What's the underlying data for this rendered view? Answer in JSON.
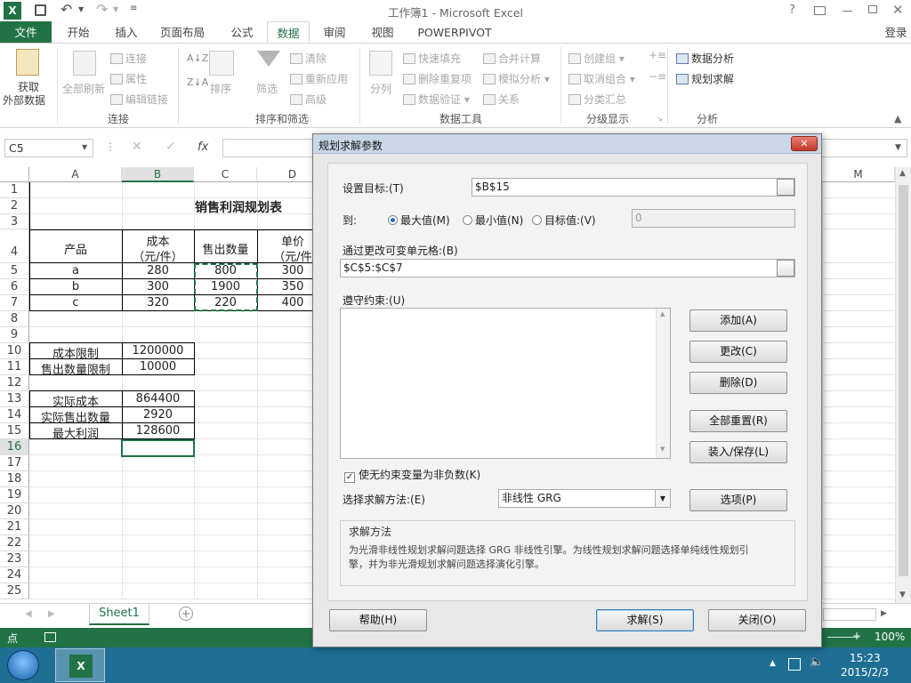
{
  "titlebar": {
    "title": "工作簿1 - Microsoft Excel",
    "help": "?",
    "login": "登录"
  },
  "tabs": {
    "file": "文件",
    "home": "开始",
    "insert": "插入",
    "layout": "页面布局",
    "formula": "公式",
    "data": "数据",
    "review": "审阅",
    "view": "视图",
    "powerpivot": "POWERPIVOT"
  },
  "ribbon": {
    "get_external_1": "获取",
    "get_external_2": "外部数据",
    "refresh_all": "全部刷新",
    "connections": "连接",
    "properties": "属性",
    "edit_links": "编辑链接",
    "group_connections": "连接",
    "sort": "排序",
    "filter": "筛选",
    "clear": "清除",
    "reapply": "重新应用",
    "advanced": "高级",
    "group_sort": "排序和筛选",
    "text_to_cols": "分列",
    "flash_fill": "快速填充",
    "remove_dup": "删除重复项",
    "validation": "数据验证",
    "consolidate": "合并计算",
    "what_if": "模拟分析",
    "relationships": "关系",
    "group_datatools": "数据工具",
    "group": "创建组",
    "ungroup": "取消组合",
    "subtotal": "分类汇总",
    "group_outline": "分级显示",
    "analysis": "数据分析",
    "solver": "规划求解",
    "group_analysis": "分析"
  },
  "formula_bar": {
    "name_box": "C5",
    "fx": "fx"
  },
  "columns": [
    "A",
    "B",
    "C",
    "D",
    "M"
  ],
  "rows": [
    "1",
    "2",
    "3",
    "4",
    "5",
    "6",
    "7",
    "8",
    "9",
    "10",
    "11",
    "12",
    "13",
    "14",
    "15",
    "16",
    "17",
    "18",
    "19",
    "20",
    "21",
    "22",
    "23",
    "24",
    "25"
  ],
  "sheet": {
    "title": "销售利润规划表",
    "headers": {
      "product": "产品",
      "cost_1": "成本",
      "cost_2": "（元/件）",
      "qty": "售出数量",
      "price_1": "单价",
      "price_2": "（元/件"
    },
    "products": [
      {
        "name": "a",
        "cost": "280",
        "qty": "800",
        "price": "300"
      },
      {
        "name": "b",
        "cost": "300",
        "qty": "1900",
        "price": "350"
      },
      {
        "name": "c",
        "cost": "320",
        "qty": "220",
        "price": "400"
      }
    ],
    "cost_limit_label": "成本限制",
    "cost_limit": "1200000",
    "qty_limit_label": "售出数量限制",
    "qty_limit": "10000",
    "actual_cost_label": "实际成本",
    "actual_cost": "864400",
    "actual_qty_label": "实际售出数量",
    "actual_qty": "2920",
    "max_profit_label": "最大利润",
    "max_profit": "128600"
  },
  "sheet_tab": "Sheet1",
  "status": {
    "mode": "点",
    "zoom": "100%"
  },
  "taskbar": {
    "time": "15:23",
    "date": "2015/2/3"
  },
  "dialog": {
    "title": "规划求解参数",
    "set_objective_label": "设置目标:(T)",
    "set_objective_value": "$B$15",
    "to_label": "到:",
    "max_label": "最大值(M)",
    "min_label": "最小值(N)",
    "value_label": "目标值:(V)",
    "value_input": "0",
    "changing_label": "通过更改可变单元格:(B)",
    "changing_value": "$C$5:$C$7",
    "constraints_label": "遵守约束:(U)",
    "btn_add": "添加(A)",
    "btn_change": "更改(C)",
    "btn_delete": "删除(D)",
    "btn_reset": "全部重置(R)",
    "btn_load": "装入/保存(L)",
    "nonneg_label": "使无约束变量为非负数(K)",
    "method_label": "选择求解方法:(E)",
    "method_value": "非线性 GRG",
    "btn_options": "选项(P)",
    "solving_title": "求解方法",
    "solving_text_1": "为光滑非线性规划求解问题选择 GRG 非线性引擎。为线性规划求解问题选择单纯线性规划引",
    "solving_text_2": "擎，并为非光滑规划求解问题选择演化引擎。",
    "btn_help": "帮助(H)",
    "btn_solve": "求解(S)",
    "btn_close": "关闭(O)"
  }
}
